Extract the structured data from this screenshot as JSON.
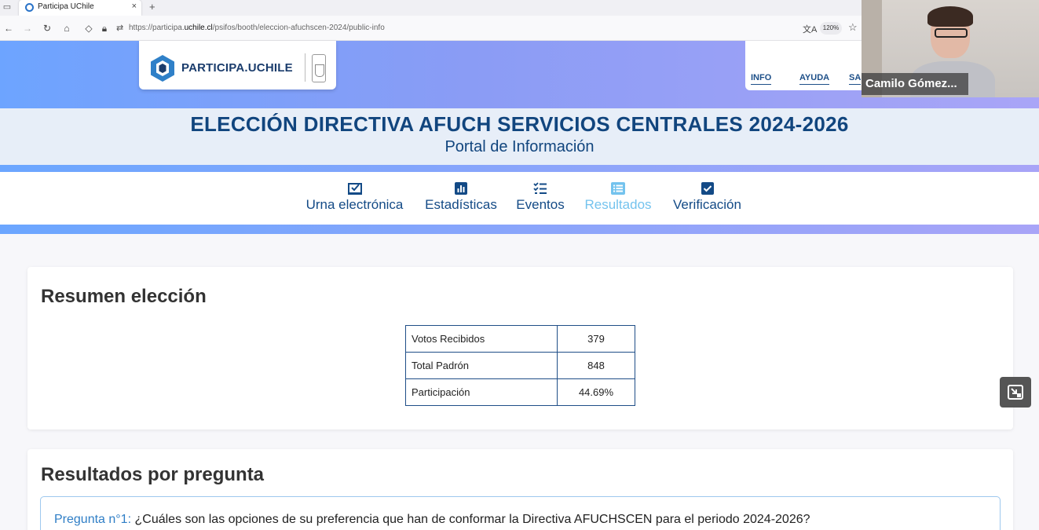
{
  "browser": {
    "tab_title": "Participa UChile",
    "tab_close": "×",
    "new_tab": "+",
    "url_prefix": "https://participa.",
    "url_domain": "uchile.cl",
    "url_path": "/psifos/booth/eleccion-afuchscen-2024/public-info",
    "zoom": "120%"
  },
  "header": {
    "logo_text": "PARTICIPA.UCHILE",
    "menu": [
      "INFO",
      "AYUDA",
      "SA"
    ],
    "title": "ELECCIÓN DIRECTIVA AFUCH SERVICIOS CENTRALES 2024-2026",
    "subtitle": "Portal de Información"
  },
  "nav": {
    "items": [
      {
        "label": "Urna electrónica",
        "icon": "ballot-box-icon"
      },
      {
        "label": "Estadísticas",
        "icon": "bar-chart-icon"
      },
      {
        "label": "Eventos",
        "icon": "checklist-icon"
      },
      {
        "label": "Resultados",
        "icon": "list-icon",
        "active": true
      },
      {
        "label": "Verificación",
        "icon": "check-square-icon"
      }
    ]
  },
  "summary": {
    "title": "Resumen elección",
    "rows": [
      {
        "label": "Votos Recibidos",
        "value": "379"
      },
      {
        "label": "Total Padrón",
        "value": "848"
      },
      {
        "label": "Participación",
        "value": "44.69%"
      }
    ]
  },
  "results": {
    "title": "Resultados por pregunta",
    "question_label": "Pregunta n°1:",
    "question_text": "¿Cuáles son las opciones de su preferencia que han de conformar la Directiva AFUCHSCEN para el periodo 2024-2026?"
  },
  "video_call": {
    "participant_name": "Camilo Gómez..."
  },
  "colors": {
    "brand_dark": "#11457e",
    "active_nav": "#74c3ee",
    "question_accent": "#2f7ec6"
  }
}
